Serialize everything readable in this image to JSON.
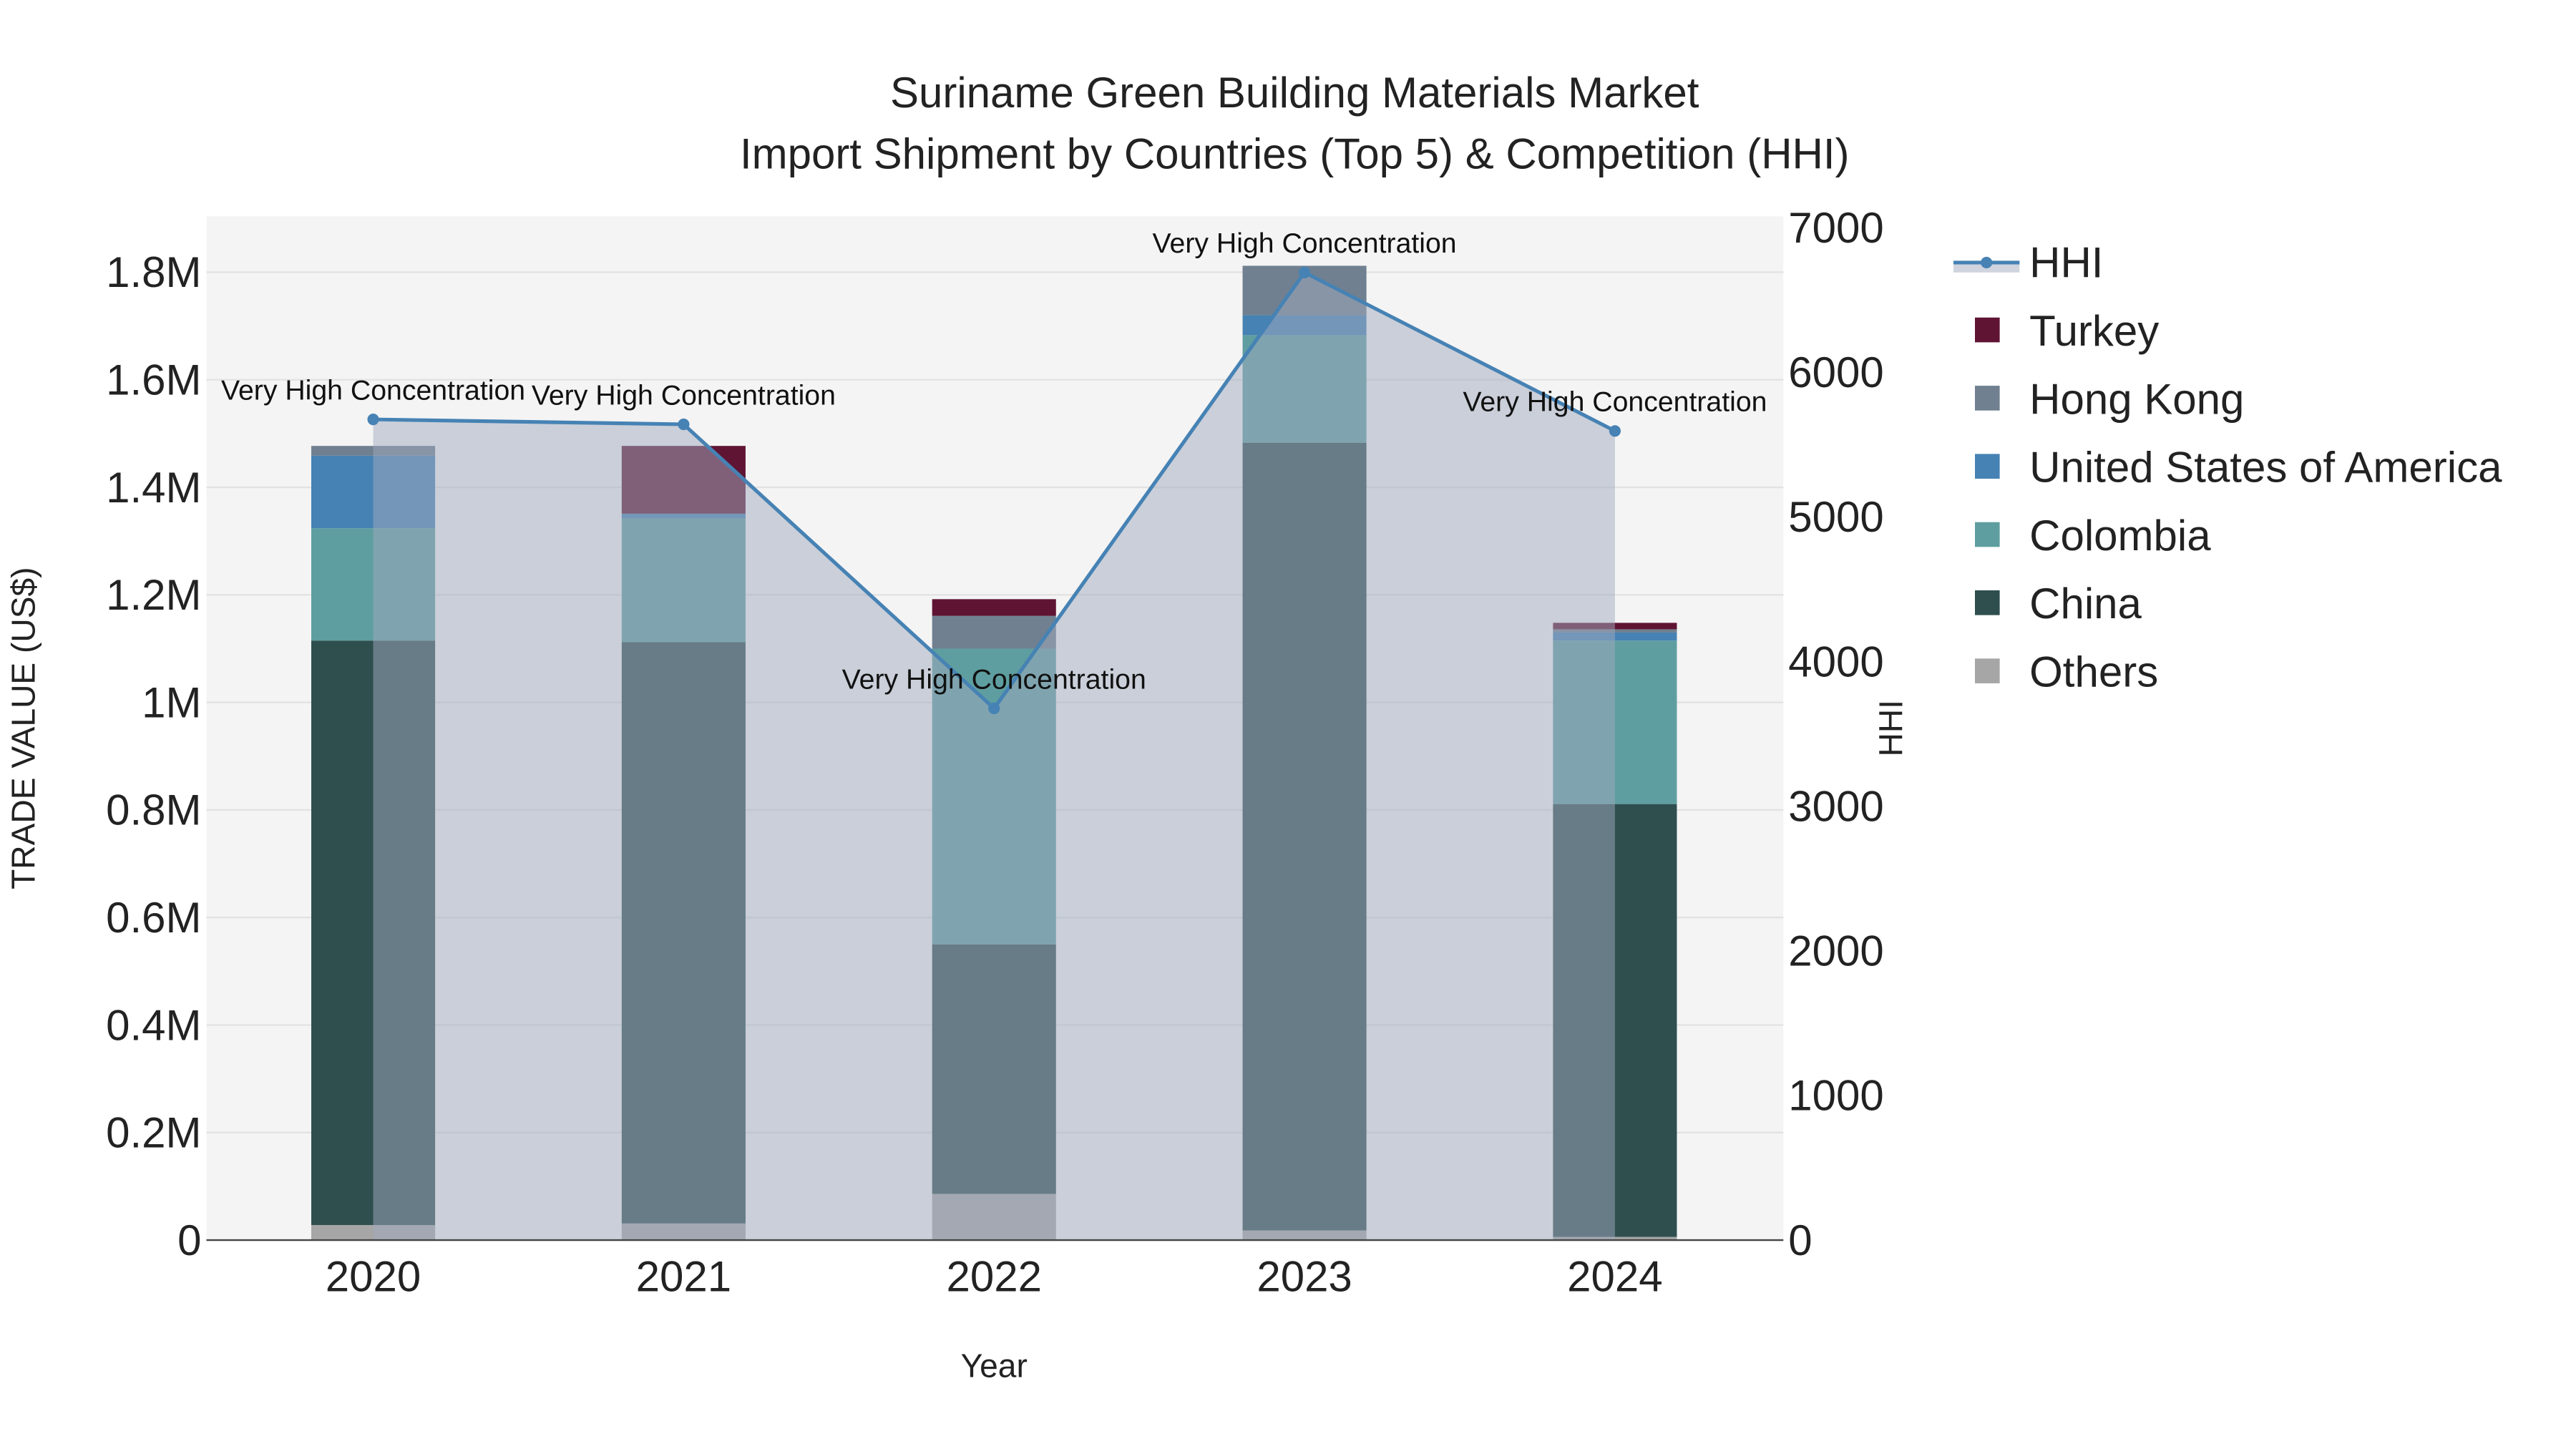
{
  "chart_data": {
    "type": "bar",
    "title": "Suriname Green Building Materials Market",
    "subtitle": "Import Shipment by Countries (Top 5) & Competition (HHI)",
    "xlabel": "Year",
    "ylabel": "TRADE VALUE (US$)",
    "y2label": "HHI",
    "categories": [
      "2020",
      "2021",
      "2022",
      "2023",
      "2024"
    ],
    "stacked": true,
    "ylim": [
      0,
      1904000
    ],
    "y2lim": [
      0,
      7078
    ],
    "yticks": [
      0,
      200000,
      400000,
      600000,
      800000,
      1000000,
      1200000,
      1400000,
      1600000,
      1800000
    ],
    "ytick_labels": [
      "0",
      "0.2M",
      "0.4M",
      "0.6M",
      "0.8M",
      "1M",
      "1.2M",
      "1.4M",
      "1.6M",
      "1.8M"
    ],
    "y2ticks": [
      0,
      1000,
      2000,
      3000,
      4000,
      5000,
      6000,
      7000
    ],
    "y2tick_labels": [
      "0",
      "1000",
      "2000",
      "3000",
      "4000",
      "5000",
      "6000",
      "7000"
    ],
    "grid": true,
    "legend_position": "right",
    "series": [
      {
        "name": "Others",
        "color": "#a6a6a6",
        "values": [
          28000,
          31000,
          86000,
          18000,
          6000
        ]
      },
      {
        "name": "China",
        "color": "#2f4f4f",
        "values": [
          1087000,
          1081000,
          464000,
          1465000,
          805000
        ]
      },
      {
        "name": "Colombia",
        "color": "#5f9ea0",
        "values": [
          209000,
          230000,
          550000,
          200000,
          304000
        ]
      },
      {
        "name": "United States of America",
        "color": "#4682b4",
        "values": [
          135000,
          9000,
          0,
          37000,
          15000
        ]
      },
      {
        "name": "Hong Kong",
        "color": "#708090",
        "values": [
          18000,
          0,
          61000,
          92000,
          6000
        ]
      },
      {
        "name": "Turkey",
        "color": "#601434",
        "values": [
          0,
          126000,
          31000,
          0,
          12000
        ]
      }
    ],
    "line_series": {
      "name": "HHI",
      "color": "#4682b4",
      "axis": "y2",
      "values": [
        5674,
        5640,
        3676,
        6690,
        5594
      ],
      "annotations": [
        "Very High Concentration",
        "Very High Concentration",
        "Very High Concentration",
        "Very High Concentration",
        "Very High Concentration"
      ]
    },
    "legend": [
      "HHI",
      "Turkey",
      "Hong Kong",
      "United States of America",
      "Colombia",
      "China",
      "Others"
    ]
  }
}
